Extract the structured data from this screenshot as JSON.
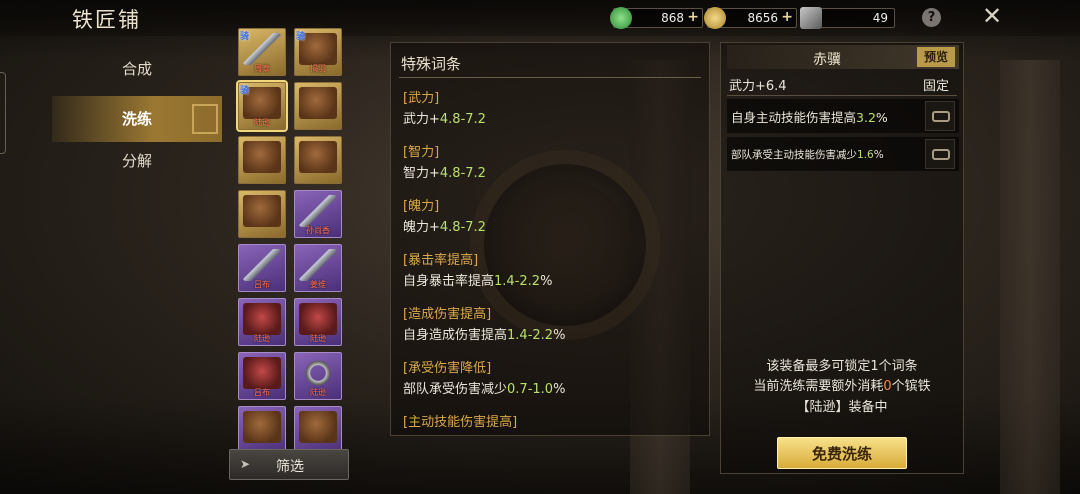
{
  "window": {
    "title": "铁匠铺"
  },
  "resources": [
    {
      "name": "jade-icon",
      "value": "868",
      "color": "#3fae4a"
    },
    {
      "name": "copper-coin-icon",
      "value": "8656",
      "color": "#d9b44a"
    },
    {
      "name": "iron-ore-icon",
      "value": "49",
      "color": "#8a8a8a"
    }
  ],
  "header": {
    "help": "?",
    "close": "✕"
  },
  "nav": {
    "items": [
      {
        "label": "合成"
      },
      {
        "label": "洗练"
      },
      {
        "label": "分解"
      }
    ]
  },
  "items": [
    {
      "name": "骑",
      "label": "周泰",
      "tag": "骑",
      "kind": "weapon",
      "grade": "gold"
    },
    {
      "name": "马",
      "label": "揭羽",
      "tag": "骑",
      "kind": "horse",
      "grade": "gold"
    },
    {
      "name": "马",
      "label": "陆逊",
      "tag": "骑",
      "kind": "horse",
      "grade": "gold",
      "selected": true
    },
    {
      "name": "马",
      "label": "",
      "tag": "",
      "kind": "horse",
      "grade": "gold"
    },
    {
      "name": "马",
      "label": "",
      "tag": "",
      "kind": "horse",
      "grade": "gold"
    },
    {
      "name": "马",
      "label": "",
      "tag": "",
      "kind": "horse",
      "grade": "gold"
    },
    {
      "name": "马",
      "label": "",
      "tag": "",
      "kind": "horse",
      "grade": "gold"
    },
    {
      "name": "剑",
      "label": "孙尚香",
      "tag": "",
      "kind": "weapon",
      "grade": "purple"
    },
    {
      "name": "剑",
      "label": "吕布",
      "tag": "",
      "kind": "weapon",
      "grade": "purple"
    },
    {
      "name": "剑",
      "label": "姜维",
      "tag": "",
      "kind": "weapon",
      "grade": "purple"
    },
    {
      "name": "甲",
      "label": "陆逊",
      "tag": "",
      "kind": "armor",
      "grade": "purple"
    },
    {
      "name": "甲",
      "label": "陆逊",
      "tag": "",
      "kind": "armor",
      "grade": "purple"
    },
    {
      "name": "甲",
      "label": "吕布",
      "tag": "",
      "kind": "armor",
      "grade": "purple"
    },
    {
      "name": "戒",
      "label": "陆逊",
      "tag": "",
      "kind": "ring",
      "grade": "purple"
    },
    {
      "name": "马",
      "label": "",
      "tag": "",
      "kind": "horse",
      "grade": "purple"
    },
    {
      "name": "马",
      "label": "",
      "tag": "",
      "kind": "horse",
      "grade": "purple"
    }
  ],
  "filter": {
    "label": "筛选"
  },
  "special": {
    "header": "特殊词条",
    "attrs": [
      {
        "head": "[武力]",
        "prefix": "武力+",
        "range": "4.8-7.2",
        "suffix": ""
      },
      {
        "head": "[智力]",
        "prefix": "智力+",
        "range": "4.8-7.2",
        "suffix": ""
      },
      {
        "head": "[魄力]",
        "prefix": "魄力+",
        "range": "4.8-7.2",
        "suffix": ""
      },
      {
        "head": "[暴击率提高]",
        "prefix": "自身暴击率提高",
        "range": "1.4-2.2",
        "suffix": "%"
      },
      {
        "head": "[造成伤害提高]",
        "prefix": "自身造成伤害提高",
        "range": "1.4-2.2",
        "suffix": "%"
      },
      {
        "head": "[承受伤害降低]",
        "prefix": "部队承受伤害减少",
        "range": "0.7-1.0",
        "suffix": "%"
      },
      {
        "head": "[主动技能伤害提高]",
        "prefix": "",
        "range": "",
        "suffix": ""
      }
    ]
  },
  "equip": {
    "name": "赤骥",
    "preview": "预览",
    "base": "武力+6.4",
    "fixed": "固定",
    "attrs": [
      {
        "prefix": "自身主动技能伤害提高",
        "value": "3.2",
        "suffix": "%"
      },
      {
        "prefix": "部队承受主动技能伤害减少",
        "value": "1.6",
        "suffix": "%"
      }
    ],
    "info1": "该装备最多可锁定1个词条",
    "info2_pre": "当前洗练需要额外消耗",
    "info2_num": "0",
    "info2_post": "个镔铁",
    "info3": "【陆逊】装备中",
    "wash": "免费洗练"
  }
}
